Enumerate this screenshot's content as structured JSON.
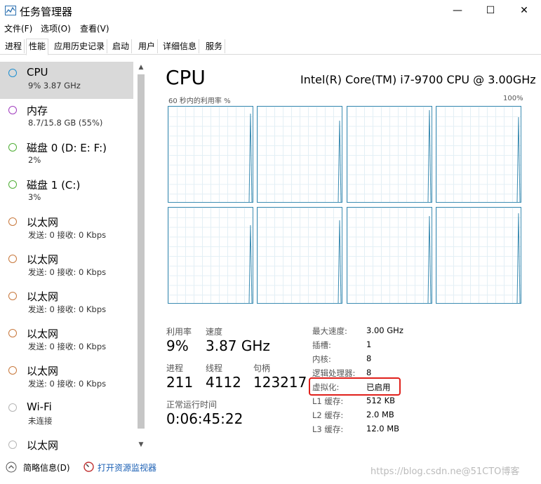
{
  "window": {
    "title": "任务管理器",
    "min_glyph": "—",
    "max_glyph": "☐",
    "close_glyph": "✕"
  },
  "menu": [
    "文件(F)",
    "选项(O)",
    "查看(V)"
  ],
  "tabs": [
    "进程",
    "性能",
    "应用历史记录",
    "启动",
    "用户",
    "详细信息",
    "服务"
  ],
  "active_tab": "性能",
  "sidebar": [
    {
      "name": "CPU",
      "sub": "9% 3.87 GHz",
      "color": "#1e8fd0",
      "selected": true
    },
    {
      "name": "内存",
      "sub": "8.7/15.8 GB (55%)",
      "color": "#a03cbe"
    },
    {
      "name": "磁盘 0 (D: E: F:)",
      "sub": "2%",
      "color": "#4fae35"
    },
    {
      "name": "磁盘 1 (C:)",
      "sub": "3%",
      "color": "#4fae35"
    },
    {
      "name": "以太网",
      "sub": "发送: 0 接收: 0 Kbps",
      "color": "#c8783c"
    },
    {
      "name": "以太网",
      "sub": "发送: 0 接收: 0 Kbps",
      "color": "#c8783c"
    },
    {
      "name": "以太网",
      "sub": "发送: 0 接收: 0 Kbps",
      "color": "#c8783c"
    },
    {
      "name": "以太网",
      "sub": "发送: 0 接收: 0 Kbps",
      "color": "#c8783c"
    },
    {
      "name": "以太网",
      "sub": "发送: 0 接收: 0 Kbps",
      "color": "#c8783c"
    },
    {
      "name": "Wi-Fi",
      "sub": "未连接",
      "color": "#b5b5b5"
    },
    {
      "name": "以太网",
      "sub": "",
      "color": "#b5b5b5"
    }
  ],
  "cpu": {
    "title": "CPU",
    "model": "Intel(R) Core(TM) i7-9700 CPU @ 3.00GHz",
    "graph_label": "60 秒内的利用率 %",
    "graph_max": "100%",
    "graph_color": "#3c8cb2"
  },
  "stats": {
    "util_label": "利用率",
    "util_value": "9%",
    "speed_label": "速度",
    "speed_value": "3.87 GHz",
    "proc_label": "进程",
    "proc_value": "211",
    "thread_label": "线程",
    "thread_value": "4112",
    "handle_label": "句柄",
    "handle_value": "123217",
    "uptime_label": "正常运行时间",
    "uptime_value": "0:06:45:22"
  },
  "specs": [
    {
      "label": "最大速度:",
      "value": "3.00 GHz"
    },
    {
      "label": "插槽:",
      "value": "1"
    },
    {
      "label": "内核:",
      "value": "8"
    },
    {
      "label": "逻辑处理器:",
      "value": "8"
    },
    {
      "label": "虚拟化:",
      "value": "已启用"
    },
    {
      "label": "L1 缓存:",
      "value": "512 KB"
    },
    {
      "label": "L2 缓存:",
      "value": "2.0 MB"
    },
    {
      "label": "L3 缓存:",
      "value": "12.0 MB"
    }
  ],
  "footer": {
    "summary": "简略信息(D)",
    "monitor": "打开资源监视器"
  },
  "watermark": "https://blog.csdn.ne@51CTO博客"
}
